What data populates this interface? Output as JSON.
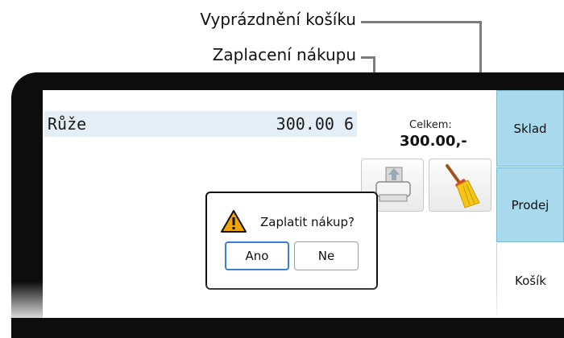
{
  "callouts": {
    "clear_cart": "Vyprázdnění košíku",
    "pay": "Zaplacení nákupu"
  },
  "cart": {
    "items": [
      {
        "name": "Růže",
        "price_qty": "300.00 6"
      }
    ],
    "total_label": "Celkem:",
    "total_value": "300.00,-"
  },
  "actions": {
    "pay_icon": "printer-icon",
    "clear_icon": "broom-icon"
  },
  "tabs": [
    {
      "label": "Sklad",
      "active": false
    },
    {
      "label": "Prodej",
      "active": false
    },
    {
      "label": "Košík",
      "active": true
    }
  ],
  "dialog": {
    "icon": "warning-icon",
    "message": "Zaplatit nákup?",
    "confirm_label": "Ano",
    "cancel_label": "Ne"
  },
  "colors": {
    "tab_inactive": "#a8d9ec",
    "row_highlight": "#e3eef7",
    "focus_border": "#3b7fd4",
    "warning": "#f2a400"
  }
}
